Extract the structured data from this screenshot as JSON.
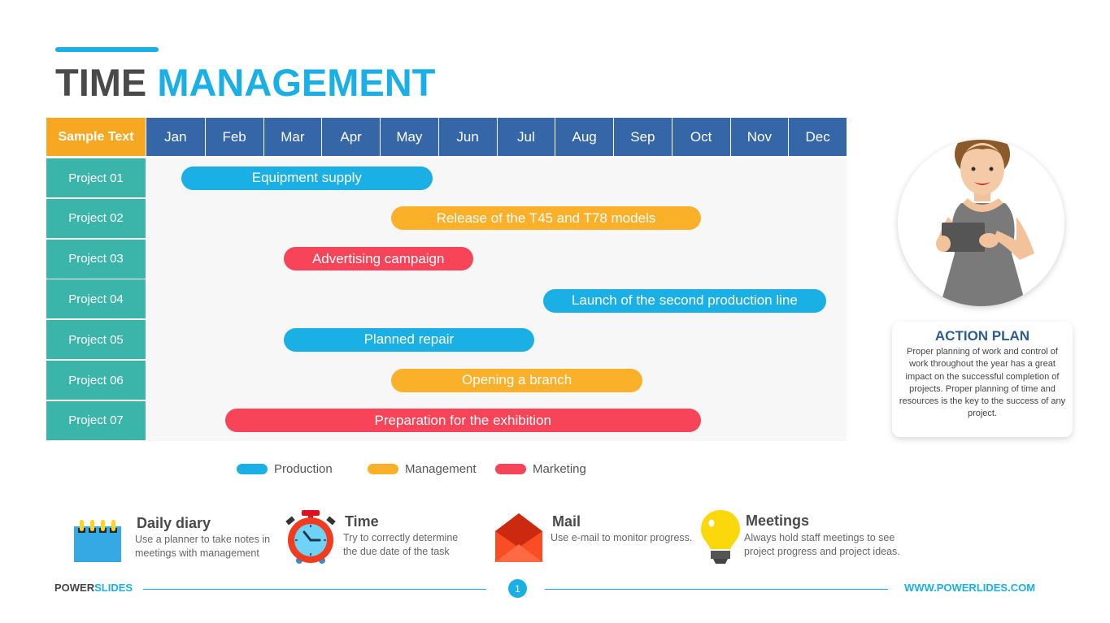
{
  "title": {
    "part1": "TIME",
    "part2": "MANAGEMENT"
  },
  "colors": {
    "accent": "#1ab0e6",
    "header_month": "#3466a8",
    "header_corner": "#f7a823",
    "row_label": "#3bb5a9",
    "Production": "#1ab0e6",
    "Management": "#fbb02a",
    "Marketing": "#f84459"
  },
  "chart_data": {
    "type": "gantt",
    "title": "TIME MANAGEMENT",
    "corner_label": "Sample Text",
    "categories": [
      "Jan",
      "Feb",
      "Mar",
      "Apr",
      "May",
      "Jun",
      "Jul",
      "Aug",
      "Sep",
      "Oct",
      "Nov",
      "Dec"
    ],
    "x_range_months": [
      0,
      12
    ],
    "rows": [
      {
        "label": "Project 01",
        "task": "Equipment supply",
        "category": "Production",
        "start": 0.6,
        "end": 4.9
      },
      {
        "label": "Project 02",
        "task": "Release of the T45 and T78 models",
        "category": "Management",
        "start": 4.2,
        "end": 9.5
      },
      {
        "label": "Project 03",
        "task": "Advertising campaign",
        "category": "Marketing",
        "start": 2.35,
        "end": 5.6
      },
      {
        "label": "Project 04",
        "task": "Launch of the second production line",
        "category": "Production",
        "start": 6.8,
        "end": 11.65
      },
      {
        "label": "Project 05",
        "task": "Planned repair",
        "category": "Production",
        "start": 2.35,
        "end": 6.65
      },
      {
        "label": "Project 06",
        "task": "Opening a branch",
        "category": "Management",
        "start": 4.2,
        "end": 8.5
      },
      {
        "label": "Project 07",
        "task": "Preparation for the exhibition",
        "category": "Marketing",
        "start": 1.35,
        "end": 9.5
      }
    ],
    "legend": [
      "Production",
      "Management",
      "Marketing"
    ],
    "legend_position": "bottom"
  },
  "action_plan": {
    "title": "ACTION PLAN",
    "body": "Proper planning of work and control of work throughout the year has a great impact on the successful completion of projects. Proper planning of time and resources is the key to the success of any project."
  },
  "features": [
    {
      "icon": "notebook-icon",
      "title": "Daily diary",
      "line1": "Use a planner to take notes in",
      "line2": "meetings with management"
    },
    {
      "icon": "stopwatch-icon",
      "title": "Time",
      "line1": "Try to correctly determine",
      "line2": "the due date of the task"
    },
    {
      "icon": "envelope-icon",
      "title": "Mail",
      "line1": "Use e-mail to monitor progress.",
      "line2": ""
    },
    {
      "icon": "lightbulb-icon",
      "title": "Meetings",
      "line1": "Always hold staff meetings to see",
      "line2": "project progress and project ideas."
    }
  ],
  "footer": {
    "brand1": "POWER",
    "brand2": "SLIDES",
    "page": "1",
    "url": "WWW.POWERLIDES.COM"
  }
}
